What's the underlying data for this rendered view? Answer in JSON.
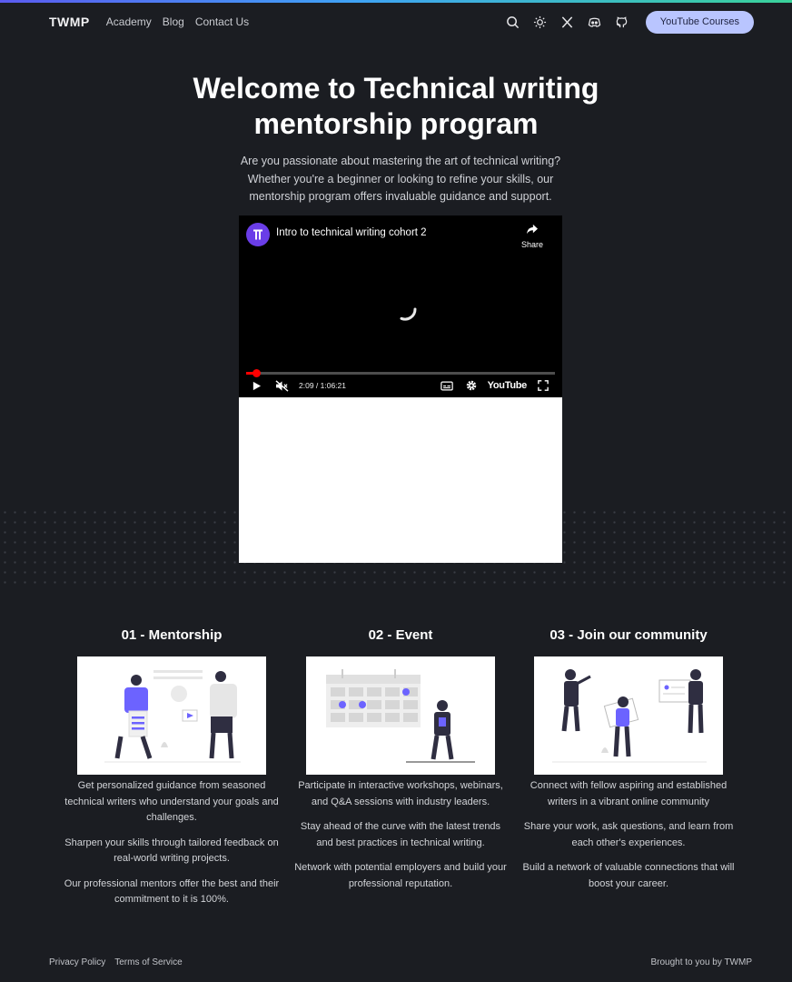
{
  "nav": {
    "brand": "TWMP",
    "links": [
      "Academy",
      "Blog",
      "Contact Us"
    ],
    "cta": "YouTube Courses",
    "icons": [
      "search-icon",
      "sun-icon",
      "x-twitter-icon",
      "discord-icon",
      "github-icon"
    ]
  },
  "hero": {
    "title_line1": "Welcome to Technical writing",
    "title_line2": "mentorship program",
    "subtitle": "Are you passionate about mastering the art of technical writing? Whether you're a beginner or looking to refine your skills, our mentorship program offers invaluable guidance and support."
  },
  "video": {
    "title": "Intro to technical writing cohort 2",
    "share_label": "Share",
    "time": "2:09 / 1:06:21",
    "progress_fraction": 0.033,
    "brand": "YouTube"
  },
  "features": [
    {
      "title": "01 - Mentorship",
      "paragraphs": [
        "Get personalized guidance from seasoned technical writers who understand your goals and challenges.",
        "Sharpen your skills through tailored feedback on real-world writing projects.",
        "Our professional mentors offer the best and their commitment to it is 100%."
      ]
    },
    {
      "title": "02 - Event",
      "paragraphs": [
        "Participate in interactive workshops, webinars, and Q&A sessions with industry leaders.",
        "Stay ahead of the curve with the latest trends and best practices in technical writing.",
        "Network with potential employers and build your professional reputation."
      ]
    },
    {
      "title": "03 - Join our community",
      "paragraphs": [
        "Connect with fellow aspiring and established writers in a vibrant online community",
        "Share your work, ask questions, and learn from each other's experiences.",
        "Build a network of valuable connections that will boost your career."
      ]
    }
  ],
  "footer": {
    "privacy": "Privacy Policy",
    "terms": "Terms of Service",
    "credit": "Brought to you by TWMP"
  },
  "colors": {
    "background": "#1b1d22",
    "accent": "#6c63ff",
    "cta_bg": "#b9c5ff",
    "progress": "#ff0000"
  }
}
